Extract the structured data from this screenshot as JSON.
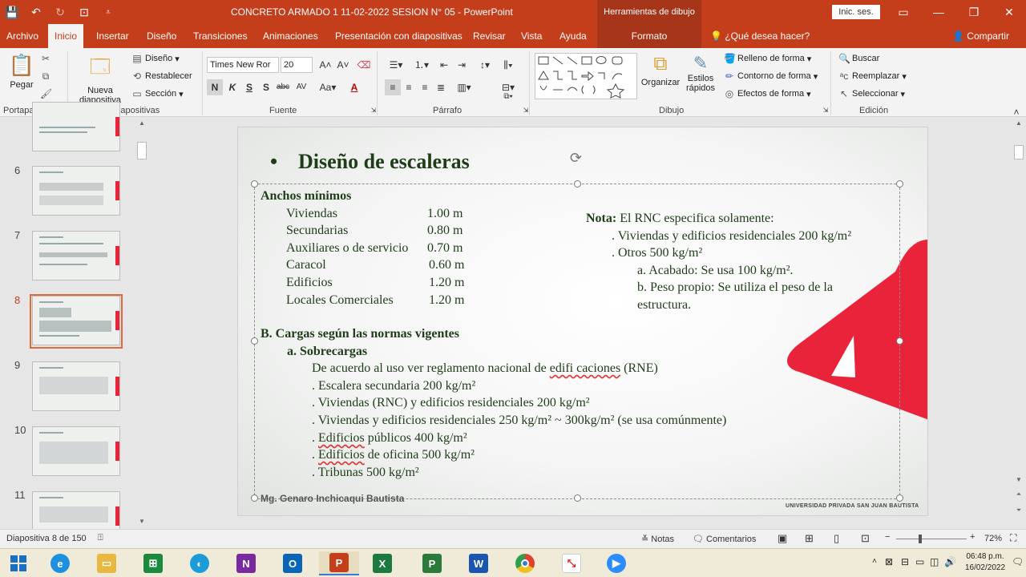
{
  "window": {
    "title": "CONCRETO ARMADO 1  11-02-2022  SESION N° 05  -  PowerPoint",
    "context_tools": "Herramientas de dibujo",
    "signin": "Inic. ses.",
    "qat_more": "⩡"
  },
  "tabs": [
    "Archivo",
    "Inicio",
    "Insertar",
    "Diseño",
    "Transiciones",
    "Animaciones",
    "Presentación con diapositivas",
    "Revisar",
    "Vista",
    "Ayuda"
  ],
  "tab_formato": "Formato",
  "tell_me": "¿Qué desea hacer?",
  "share": "Compartir",
  "ribbon": {
    "paste": "Pegar",
    "new_slide": "Nueva",
    "new_slide2": "diapositiva",
    "layout": "Diseño",
    "reset": "Restablecer",
    "section": "Sección",
    "font_name": "Times New Ror",
    "font_size": "20",
    "arrange": "Organizar",
    "quick_styles": "Estilos",
    "quick_styles2": "rápidos",
    "fill": "Relleno de forma",
    "outline": "Contorno de forma",
    "effects": "Efectos de forma",
    "find": "Buscar",
    "replace": "Reemplazar",
    "select": "Seleccionar",
    "groups": {
      "clipboard": "Portapapeles",
      "slides": "Diapositivas",
      "font": "Fuente",
      "paragraph": "Párrafo",
      "drawing": "Dibujo",
      "editing": "Edición"
    }
  },
  "thumbnails": [
    {
      "num": "6"
    },
    {
      "num": "7"
    },
    {
      "num": "8"
    },
    {
      "num": "9"
    },
    {
      "num": "10"
    },
    {
      "num": "11"
    }
  ],
  "slide": {
    "title": "Diseño de escaleras",
    "anchos_title": "Anchos mínimos",
    "anchos": [
      {
        "label": "Viviendas",
        "value": "1.00 m"
      },
      {
        "label": "Secundarias",
        "value": "0.80 m"
      },
      {
        "label": "Auxiliares o de servicio",
        "value": "0.70 m"
      },
      {
        "label": "Caracol",
        "value": "0.60 m"
      },
      {
        "label": "Edificios",
        "value": "1.20 m"
      },
      {
        "label": "Locales Comerciales",
        "value": "1.20 m"
      }
    ],
    "nota_label": "Nota:",
    "nota_text": "El RNC especifica solamente:",
    "nota_lines": [
      ". Viviendas y edificios residenciales 200 kg/m²",
      ". Otros 500 kg/m²"
    ],
    "nota_sub": [
      "a. Acabado: Se usa 100 kg/m².",
      "b. Peso propio: Se utiliza el peso de la",
      "estructura."
    ],
    "cargas_title": "B. Cargas según las normas vigentes",
    "sobrecargas": "a. Sobrecargas",
    "rne_pre": "De acuerdo al uso ver reglamento nacional de ",
    "rne_sq": "edifi caciones",
    "rne_post": " (RNE)",
    "cargas_lines": [
      ". Escalera secundaria 200 kg/m²",
      ". Viviendas (RNC) y edificios residenciales 200 kg/m²",
      ". Viviendas y edificios residenciales 250 kg/m² ~ 300kg/m² (se usa comúnmente)"
    ],
    "edif_publicos": "Edificios",
    "edif_publicos_rest": " públicos 400 kg/m²",
    "edif_oficina": "Edificios",
    "edif_oficina_rest": " de oficina 500 kg/m²",
    "tribunas": ". Tribunas 500 kg/m²",
    "dot": ". ",
    "footer_left": "Mg.  Genaro Inchicaqui Bautista",
    "footer_right": "UNIVERSIDAD PRIVADA SAN JUAN BAUTISTA"
  },
  "status": {
    "slide_info": "Diapositiva 8 de 150",
    "notes": "Notas",
    "comments": "Comentarios",
    "zoom": "72%"
  },
  "taskbar": {
    "time": "06:48 p.m.",
    "date": "16/02/2022"
  },
  "colors": {
    "accent": "#c43e1c",
    "slide_text": "#1e3d18",
    "deco_red": "#e8233a"
  }
}
